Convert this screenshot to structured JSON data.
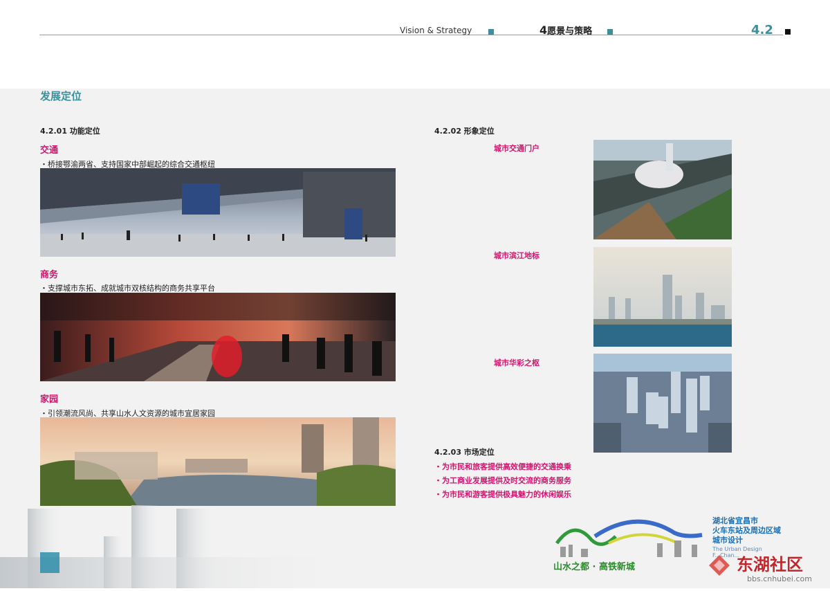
{
  "header": {
    "english": "Vision & Strategy",
    "chapter_number": "4",
    "chapter_title": "愿景与策略",
    "section_number": "4.2"
  },
  "section_title": "发展定位",
  "functional": {
    "heading": "4.2.01 功能定位",
    "items": [
      {
        "category": "交通",
        "bullet": "・桥接鄂渝两省、支持国家中部崛起的综合交通枢纽"
      },
      {
        "category": "商务",
        "bullet": "・支撑城市东拓、成就城市双核结构的商务共享平台"
      },
      {
        "category": "家园",
        "bullet": "・引领潮流风尚、共享山水人文资源的城市宜居家园"
      }
    ]
  },
  "image_positioning": {
    "heading": "4.2.02 形象定位",
    "labels": [
      "城市交通门户",
      "城市滨江地标",
      "城市华彩之枢"
    ]
  },
  "market": {
    "heading": "4.2.03 市场定位",
    "items": [
      "・为市民和旅客提供高效便捷的交通换乘",
      "・为工商业发展提供及时交流的商务服务",
      "・为市民和游客提供极具魅力的休闲娱乐"
    ]
  },
  "logo": {
    "cn_lines": [
      "湖北省宜昌市",
      "火车东站及周边区域",
      "城市设计"
    ],
    "en_lines": [
      "The Urban Design",
      "F...Chan...",
      "..."
    ],
    "slogan": "山水之都 · 高铁新城"
  },
  "watermark": {
    "name": "东湖社区",
    "url": "bbs.cnhubei.com"
  },
  "colors": {
    "accent_teal": "#3c8f9c",
    "accent_magenta": "#d4146f",
    "panel_grey": "#f2f2f2"
  }
}
